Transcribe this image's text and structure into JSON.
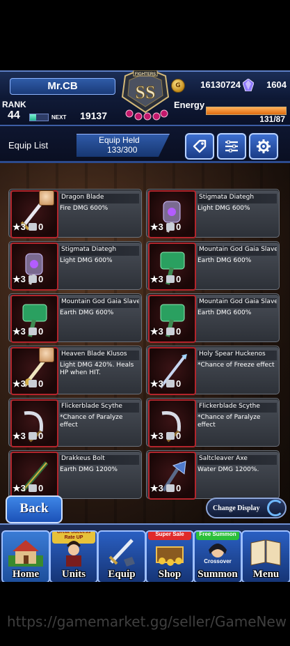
{
  "header": {
    "player_name": "Mr.CB",
    "emblem_text": "SS",
    "emblem_banner": "FIGHTERS",
    "gil": "16130724",
    "gil_icon": "coin-icon",
    "lapis": "1604",
    "lapis_icon": "crystal-icon",
    "rank_label": "RANK",
    "rank": "44",
    "next_label": "NEXT",
    "next_exp": "19137",
    "exp_progress": 0.35,
    "energy_label": "Energy",
    "energy": "131/87",
    "energy_progress": 1.0
  },
  "subheader": {
    "equip_list_label": "Equip List",
    "equip_held_label": "Equip Held",
    "equip_held_value": "133/300",
    "buttons": [
      "tag-icon",
      "filter-icon",
      "gear-icon"
    ]
  },
  "equipment": [
    {
      "name": "Dragon Blade",
      "desc": "Fire DMG 600%",
      "stars": "3",
      "qty": "0"
    },
    {
      "name": "Stigmata Diategh",
      "desc": "Light DMG 600%",
      "stars": "3",
      "qty": "0"
    },
    {
      "name": "Stigmata Diategh",
      "desc": "Light DMG 600%",
      "stars": "3",
      "qty": "0"
    },
    {
      "name": "Mountain God Gaia Slave",
      "desc": "Earth DMG 600%",
      "stars": "3",
      "qty": "0"
    },
    {
      "name": "Mountain God Gaia Slave",
      "desc": "Earth DMG 600%",
      "stars": "3",
      "qty": "0"
    },
    {
      "name": "Mountain God Gaia Slave",
      "desc": "Earth DMG 600%",
      "stars": "3",
      "qty": "0"
    },
    {
      "name": "Heaven Blade Klusos",
      "desc": "Light DMG 420%. Heals HP when HIT.",
      "stars": "3",
      "qty": "0"
    },
    {
      "name": "Holy Spear Huckenos",
      "desc": "*Chance of Freeze effect",
      "stars": "3",
      "qty": "0"
    },
    {
      "name": "Flickerblade Scythe",
      "desc": "*Chance of Paralyze effect",
      "stars": "3",
      "qty": "0"
    },
    {
      "name": "Flickerblade Scythe",
      "desc": "*Chance of Paralyze effect",
      "stars": "3",
      "qty": "0"
    },
    {
      "name": "Drakkeus Bolt",
      "desc": "Earth DMG 1200%",
      "stars": "3",
      "qty": "0"
    },
    {
      "name": "Saltcleaver Axe",
      "desc": "Water DMG 1200%.",
      "stars": "3",
      "qty": "0"
    }
  ],
  "back_label": "Back",
  "change_display_label": "Change Display",
  "nav": [
    {
      "label": "Home",
      "tag": ""
    },
    {
      "label": "Units",
      "tag": "Great Success Rate UP"
    },
    {
      "label": "Equip",
      "tag": ""
    },
    {
      "label": "Shop",
      "tag": "Super Sale"
    },
    {
      "label": "Summon",
      "tag": "Free Summon"
    },
    {
      "label": "Menu",
      "tag": ""
    }
  ],
  "summon_sub_label": "Crossover",
  "colors": {
    "rarity_border": "#b3252c",
    "accent_blue": "#2a5fc2",
    "energy": "#e06b10",
    "exp": "#23b58f",
    "super_sale": "#e02a2a",
    "free_summon": "#2bbf3a",
    "great_success": "#e7c23a"
  },
  "watermark": "https://gamemarket.gg/seller/GameNew"
}
